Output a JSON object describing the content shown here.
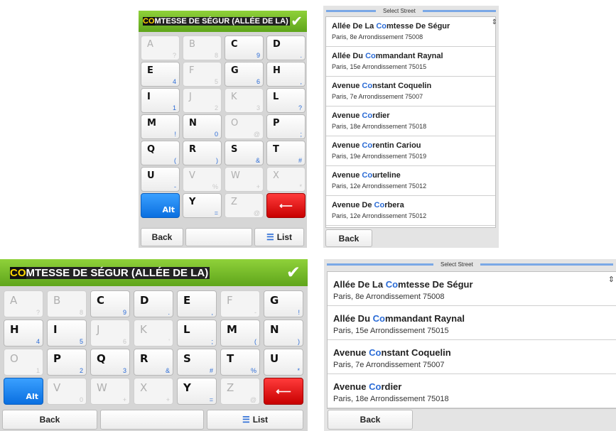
{
  "keyboard": {
    "typed_match": "CO",
    "typed_rest": "MTESSE DE SÉGUR (ALLÉE DE LA)",
    "alt_label": "Alt",
    "delete_symbol": "⟵",
    "back_label": "Back",
    "list_label": "List",
    "list_icon": "☰",
    "check_icon": "✔",
    "small_rows": [
      [
        {
          "c": "A",
          "s": "?",
          "d": true
        },
        {
          "c": "B",
          "s": "8",
          "d": true
        },
        {
          "c": "C",
          "s": "9",
          "d": false
        },
        {
          "c": "D",
          "s": ".",
          "d": false
        }
      ],
      [
        {
          "c": "E",
          "s": "4",
          "d": false
        },
        {
          "c": "F",
          "s": "5",
          "d": true
        },
        {
          "c": "G",
          "s": "6",
          "d": false
        },
        {
          "c": "H",
          "s": ",",
          "d": false
        }
      ],
      [
        {
          "c": "I",
          "s": "1",
          "d": false
        },
        {
          "c": "J",
          "s": "2",
          "d": true
        },
        {
          "c": "K",
          "s": "3",
          "d": true
        },
        {
          "c": "L",
          "s": "?",
          "d": false
        }
      ],
      [
        {
          "c": "M",
          "s": "!",
          "d": false
        },
        {
          "c": "N",
          "s": "0",
          "d": false
        },
        {
          "c": "O",
          "s": "@",
          "d": true
        },
        {
          "c": "P",
          "s": ";",
          "d": false
        }
      ],
      [
        {
          "c": "Q",
          "s": "(",
          "d": false
        },
        {
          "c": "R",
          "s": ")",
          "d": false
        },
        {
          "c": "S",
          "s": "&",
          "d": false
        },
        {
          "c": "T",
          "s": "#",
          "d": false
        }
      ],
      [
        {
          "c": "U",
          "s": "-",
          "d": false
        },
        {
          "c": "V",
          "s": "%",
          "d": true
        },
        {
          "c": "W",
          "s": "+",
          "d": true
        },
        {
          "c": "X",
          "s": "*",
          "d": true
        }
      ],
      [
        {
          "c": "",
          "s": "",
          "d": false,
          "t": "alt"
        },
        {
          "c": "Y",
          "s": "=",
          "d": false
        },
        {
          "c": "Z",
          "s": "@",
          "d": true
        },
        {
          "c": "",
          "s": "",
          "d": false,
          "t": "del"
        }
      ]
    ],
    "large_rows": [
      [
        {
          "c": "A",
          "s": "?",
          "d": true
        },
        {
          "c": "B",
          "s": "8",
          "d": true
        },
        {
          "c": "C",
          "s": "9",
          "d": false
        },
        {
          "c": "D",
          "s": ".",
          "d": false
        },
        {
          "c": "E",
          "s": ",",
          "d": false
        },
        {
          "c": "F",
          "s": "-",
          "d": true
        },
        {
          "c": "G",
          "s": "!",
          "d": false
        }
      ],
      [
        {
          "c": "H",
          "s": "4",
          "d": false
        },
        {
          "c": "I",
          "s": "5",
          "d": false
        },
        {
          "c": "J",
          "s": "6",
          "d": true
        },
        {
          "c": "K",
          "s": "'",
          "d": true
        },
        {
          "c": "L",
          "s": ";",
          "d": false
        },
        {
          "c": "M",
          "s": "(",
          "d": false
        },
        {
          "c": "N",
          "s": ")",
          "d": false
        }
      ],
      [
        {
          "c": "O",
          "s": "1",
          "d": true
        },
        {
          "c": "P",
          "s": "2",
          "d": false
        },
        {
          "c": "Q",
          "s": "3",
          "d": false
        },
        {
          "c": "R",
          "s": "&",
          "d": false
        },
        {
          "c": "S",
          "s": "#",
          "d": false
        },
        {
          "c": "T",
          "s": "%",
          "d": false
        },
        {
          "c": "U",
          "s": "*",
          "d": false
        }
      ],
      [
        {
          "c": "",
          "s": "",
          "d": false,
          "t": "alt"
        },
        {
          "c": "V",
          "s": "0",
          "d": true
        },
        {
          "c": "W",
          "s": "+",
          "d": true
        },
        {
          "c": "X",
          "s": "+",
          "d": true
        },
        {
          "c": "Y",
          "s": "=",
          "d": false
        },
        {
          "c": "Z",
          "s": "@",
          "d": true
        },
        {
          "c": "",
          "s": "",
          "d": false,
          "t": "del"
        }
      ]
    ]
  },
  "streets": {
    "header": "Select Street",
    "back_label": "Back",
    "scroll_icon": "⇕",
    "items": [
      {
        "pre": "Allée De La ",
        "match": "Co",
        "post": "mtesse De Ségur",
        "addr": "Paris, 8e Arrondissement 75008"
      },
      {
        "pre": "Allée Du ",
        "match": "Co",
        "post": "mmandant Raynal",
        "addr": "Paris, 15e Arrondissement 75015"
      },
      {
        "pre": "Avenue ",
        "match": "Co",
        "post": "nstant Coquelin",
        "addr": "Paris, 7e Arrondissement 75007"
      },
      {
        "pre": "Avenue ",
        "match": "Co",
        "post": "rdier",
        "addr": "Paris, 18e Arrondissement 75018"
      },
      {
        "pre": "Avenue ",
        "match": "Co",
        "post": "rentin Cariou",
        "addr": "Paris, 19e Arrondissement 75019"
      },
      {
        "pre": "Avenue ",
        "match": "Co",
        "post": "urteline",
        "addr": "Paris, 12e Arrondissement 75012"
      },
      {
        "pre": "Avenue De ",
        "match": "Co",
        "post": "rbera",
        "addr": "Paris, 12e Arrondissement 75012"
      }
    ]
  }
}
